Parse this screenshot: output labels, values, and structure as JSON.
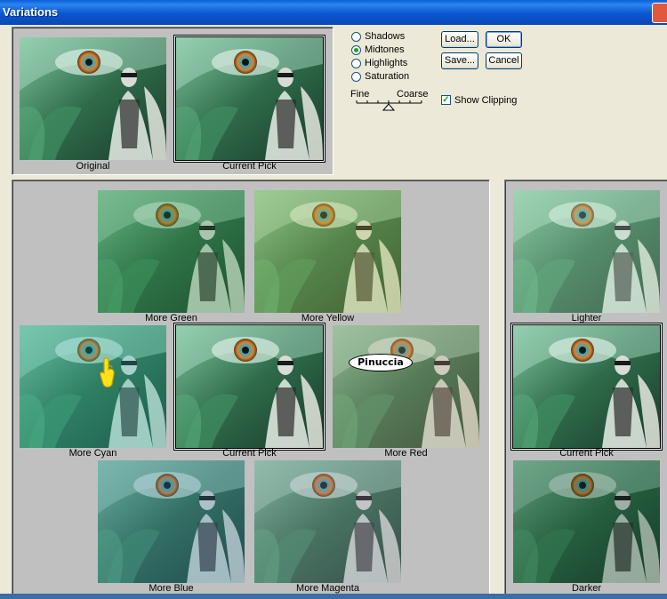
{
  "window": {
    "title": "Variations"
  },
  "thumbs": {
    "original": "Original",
    "current_pick": "Current Pick",
    "more_green": "More Green",
    "more_yellow": "More Yellow",
    "more_cyan": "More Cyan",
    "center_current_pick": "Current Pick",
    "more_red": "More Red",
    "more_blue": "More Blue",
    "more_magenta": "More Magenta",
    "lighter": "Lighter",
    "right_current_pick": "Current Pick",
    "darker": "Darker"
  },
  "tone_options": [
    {
      "label": "Shadows",
      "selected": false
    },
    {
      "label": "Midtones",
      "selected": true
    },
    {
      "label": "Highlights",
      "selected": false
    },
    {
      "label": "Saturation",
      "selected": false
    }
  ],
  "slider": {
    "min_label": "Fine",
    "max_label": "Coarse",
    "position": 0.5
  },
  "buttons": {
    "load": "Load...",
    "ok": "OK",
    "save": "Save...",
    "cancel": "Cancel"
  },
  "show_clipping": {
    "label": "Show Clipping",
    "checked": true
  },
  "watermark": "Pinuccia"
}
